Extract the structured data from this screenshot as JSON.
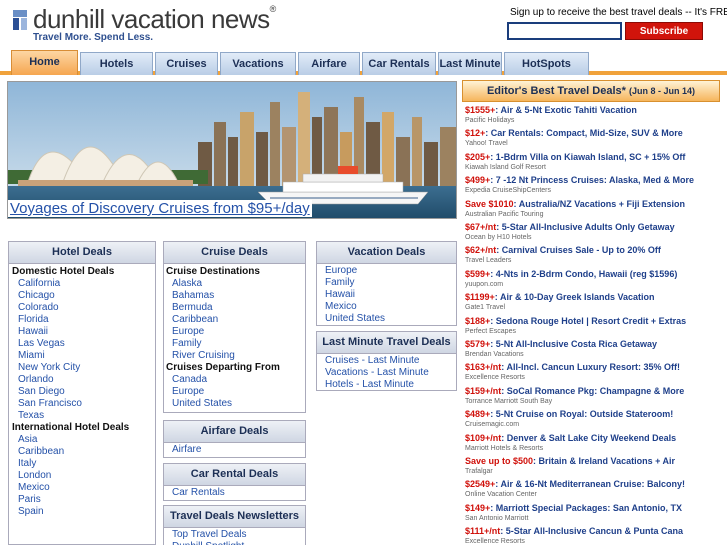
{
  "header": {
    "logo_text": "dunhill vacation news",
    "logo_reg": "®",
    "tagline": "Travel More. Spend Less.",
    "signup_text": "Sign up to receive the best travel deals -- It's FREE!",
    "signup_value": "",
    "subscribe_label": "Subscribe"
  },
  "nav": {
    "items": [
      "Home",
      "Hotels",
      "Cruises",
      "Vacations",
      "Airfare",
      "Car Rentals",
      "Last Minute",
      "HotSpots"
    ]
  },
  "hero": {
    "caption": "Voyages of Discovery Cruises from $95+/day"
  },
  "editor": {
    "title": "Editor's Best Travel Deals*",
    "dates": "(Jun 8 - Jun 14)",
    "deals": [
      {
        "price": "$1555+",
        "text": ": Air & 5-Nt Exotic Tahiti Vacation",
        "source": "Pacific Holidays"
      },
      {
        "price": "$12+",
        "text": ": Car Rentals: Compact, Mid-Size, SUV & More",
        "source": "Yahoo! Travel"
      },
      {
        "price": "$205+",
        "text": ": 1-Bdrm Villa on Kiawah Island, SC + 15% Off",
        "source": "Kiawah Island Golf Resort"
      },
      {
        "price": "$499+",
        "text": ": 7 -12 Nt Princess Cruises: Alaska, Med & More",
        "source": "Expedia CruiseShipCenters"
      },
      {
        "price": "Save $1010",
        "text": ": Australia/NZ Vacations + Fiji Extension",
        "source": "Australian Pacific Touring"
      },
      {
        "price": "$67+/nt",
        "text": ": 5-Star All-Inclusive Adults Only Getaway",
        "source": "Ocean by H10 Hotels"
      },
      {
        "price": "$62+/nt",
        "text": ": Carnival Cruises Sale - Up to 20% Off",
        "source": "Travel Leaders"
      },
      {
        "price": "$599+",
        "text": ": 4-Nts in 2-Bdrm Condo, Hawaii (reg $1596)",
        "source": "yuupon.com"
      },
      {
        "price": "$1199+",
        "text": ": Air & 10-Day Greek Islands Vacation",
        "source": "Gate1 Travel"
      },
      {
        "price": "$188+",
        "text": ": Sedona Rouge Hotel | Resort Credit + Extras",
        "source": "Perfect Escapes"
      },
      {
        "price": "$579+",
        "text": ": 5-Nt All-Inclusive Costa Rica Getaway",
        "source": "Brendan Vacations"
      },
      {
        "price": "$163+/nt",
        "text": ": All-Incl. Cancun Luxury Resort: 35% Off!",
        "source": "Excellence Resorts"
      },
      {
        "price": "$159+/nt",
        "text": ": SoCal Romance Pkg: Champagne & More",
        "source": "Torrance Marriott South Bay"
      },
      {
        "price": "$489+",
        "text": ": 5-Nt Cruise on Royal: Outside Stateroom!",
        "source": "Cruisemagic.com"
      },
      {
        "price": "$109+/nt",
        "text": ": Denver & Salt Lake City Weekend Deals",
        "source": "Marriott Hotels & Resorts"
      },
      {
        "price": "Save up to $500",
        "text": ": Britain & Ireland Vacations + Air",
        "source": "Trafalgar"
      },
      {
        "price": "$2549+",
        "text": ": Air & 16-Nt Mediterranean Cruise: Balcony!",
        "source": "Online Vacation Center"
      },
      {
        "price": "$149+",
        "text": ": Marriott Special Packages: San Antonio, TX",
        "source": "San Antonio Marriott"
      },
      {
        "price": "$111+/nt",
        "text": ": 5-Star All-Inclusive Cancun & Punta Cana",
        "source": "Excellence Resorts"
      }
    ]
  },
  "hotel_deals": {
    "title": "Hotel Deals",
    "domestic_heading": "Domestic Hotel Deals",
    "domestic": [
      "California",
      "Chicago",
      "Colorado",
      "Florida",
      "Hawaii",
      "Las Vegas",
      "Miami",
      "New York City",
      "Orlando",
      "San Diego",
      "San Francisco",
      "Texas"
    ],
    "international_heading": "International Hotel Deals",
    "international": [
      "Asia",
      "Caribbean",
      "Italy",
      "London",
      "Mexico",
      "Paris",
      "Spain"
    ]
  },
  "cruise_deals": {
    "title": "Cruise Deals",
    "dest_heading": "Cruise Destinations",
    "destinations": [
      "Alaska",
      "Bahamas",
      "Bermuda",
      "Caribbean",
      "Europe",
      "Family",
      "River Cruising"
    ],
    "depart_heading": "Cruises Departing From",
    "departing": [
      "Canada",
      "Europe",
      "United States"
    ]
  },
  "vacation_deals": {
    "title": "Vacation Deals",
    "items": [
      "Europe",
      "Family",
      "Hawaii",
      "Mexico",
      "United States"
    ]
  },
  "last_minute": {
    "title": "Last Minute Travel Deals",
    "items": [
      "Cruises - Last Minute",
      "Vacations - Last Minute",
      "Hotels - Last Minute"
    ]
  },
  "airfare_deals": {
    "title": "Airfare Deals",
    "items": [
      "Airfare"
    ]
  },
  "car_rental_deals": {
    "title": "Car Rental Deals",
    "items": [
      "Car Rentals"
    ]
  },
  "newsletters": {
    "title": "Travel Deals Newsletters",
    "items": [
      "Top Travel Deals",
      "Dunhill Spotlight"
    ]
  }
}
